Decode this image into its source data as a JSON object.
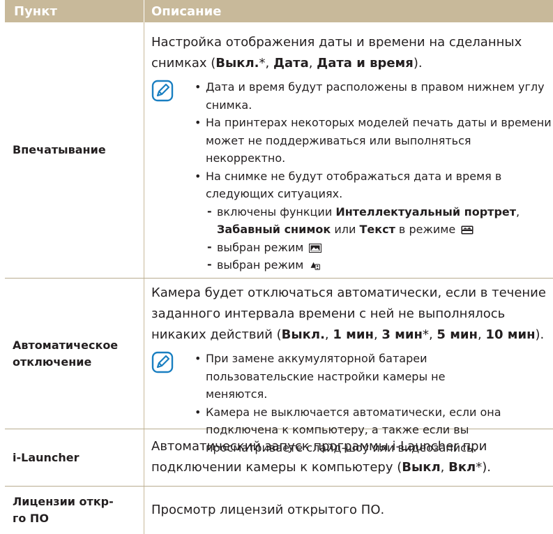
{
  "header": {
    "col1": "Пункт",
    "col2": "Описание"
  },
  "rows": [
    {
      "label": "Впечатывание",
      "main_before": "Настройка отображения даты и времени на сделанных снимках (",
      "opt1": "Выкл.",
      "opt1_suffix": "*, ",
      "opt2": "Дата",
      "sep2": ", ",
      "opt3": "Дата и время",
      "main_after": ").",
      "notes": [
        "Дата и время будут расположены в правом нижнем углу снимка.",
        "На принтерах некоторых моделей печать даты и времени может не поддерживаться или выполняться некорректно.",
        "На снимке не будут отображаться дата и время в следующих ситуациях."
      ],
      "sub1_a": "включены функции ",
      "sub1_b": "Интеллектуальный портрет",
      "sub1_c": ", ",
      "sub1_d": "Забавный снимок",
      "sub1_e": " или ",
      "sub1_f": "Текст",
      "sub1_g": " в режиме",
      "sub2": "выбран режим",
      "sub3": "выбран режим"
    },
    {
      "label": "Автоматическое отключение",
      "main_before": "Камера будет отключаться автоматически, если в течение заданного интервала времени с ней не выполнялось никаких действий (",
      "o1": "Выкл.",
      "s1": ", ",
      "o2": "1 мин",
      "s2": ", ",
      "o3": "3 мин",
      "s3": "*, ",
      "o4": "5 мин",
      "s4": ", ",
      "o5": "10 мин",
      "main_after": ").",
      "notes": [
        "При замене аккумуляторной батареи пользовательские настройки камеры не меняются.",
        "Камера не выключается автоматически, если она подключена к компьютеру, а также если вы просматриваете слайд-шоу или видеозапись."
      ]
    },
    {
      "label": "i-Launcher",
      "main_before": "Автоматический запуск программы i-Launcher при подключении камеры к компьютеру (",
      "o1": "Выкл",
      "s1": ", ",
      "o2": "Вкл",
      "main_after": "*)."
    },
    {
      "label": "Лицензии откр-го ПО",
      "main": "Просмотр лицензий открытого ПО."
    }
  ],
  "colors": {
    "header_bg": "#c8b99a",
    "rule": "#b8ab8f",
    "icon_blue": "#1a7fc1"
  },
  "icons": [
    "note-icon",
    "scene-mode-icon",
    "panorama-mode-icon",
    "smart-auto-mode-icon"
  ]
}
